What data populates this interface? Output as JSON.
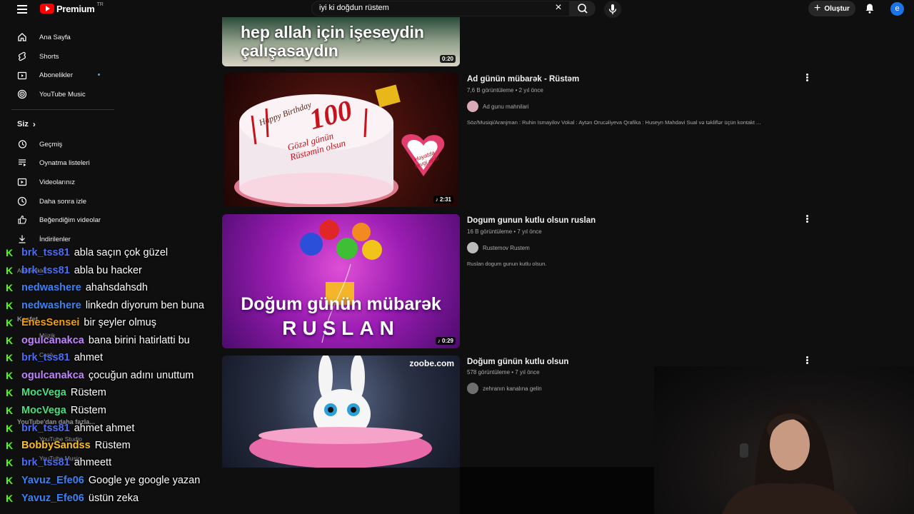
{
  "header": {
    "brand": "Premium",
    "brand_tm": "TR",
    "search_value": "iyi ki doğdun rüstem",
    "create_label": "Oluştur",
    "avatar_letter": "e"
  },
  "sidebar": {
    "items": [
      {
        "label": "Ana Sayfa",
        "icon": "home-icon"
      },
      {
        "label": "Shorts",
        "icon": "shorts-icon"
      },
      {
        "label": "Abonelikler",
        "icon": "subscriptions-icon"
      },
      {
        "label": "YouTube Music",
        "icon": "youtube-music-icon"
      }
    ],
    "you_header": "Siz",
    "you_items": [
      {
        "label": "Geçmiş",
        "icon": "history-icon"
      },
      {
        "label": "Oynatma listeleri",
        "icon": "playlists-icon"
      },
      {
        "label": "Videolarınız",
        "icon": "your-videos-icon"
      },
      {
        "label": "Daha sonra izle",
        "icon": "watch-later-icon"
      },
      {
        "label": "Beğendiğim videolar",
        "icon": "liked-videos-icon"
      },
      {
        "label": "İndirilenler",
        "icon": "downloads-icon"
      }
    ],
    "faded_items": [
      "Abonelikler",
      "Keşfet",
      "Müzik",
      "Canlı",
      "YouTube'dan daha fazla...",
      "YouTube Studio",
      "YouTube Music"
    ]
  },
  "videos": [
    {
      "title": "",
      "overlay_text": "hep allah için işeseydin çalışasaydın",
      "duration": "0:20"
    },
    {
      "title": "Ad günün mübarək - Rüstəm",
      "meta": "7,6 B görüntüleme • 2 yıl önce",
      "channel": "Ad gunu mahnilari",
      "description": "Söz/Musiqi/Aranjman : Ruhin Ismayilov Vokal : Aytən Orucəliyeva Qrafika : Huseyn Mahdavi Sual və təkliflər üçün kontakt ...",
      "duration": "2:31",
      "thumb_texts": [
        "Happy Birthday",
        "100",
        "Gözəl günün Rüstəmin olsun",
        "Həyatda sevgi dolu"
      ]
    },
    {
      "title": "Dogum gunun kutlu olsun ruslan",
      "meta": "16 B görüntüleme • 7 yıl önce",
      "channel": "Rustemov Rustem",
      "description": "Ruslan dogum gunun kutlu olsun.",
      "duration": "0:29",
      "thumb_texts": [
        "Doğum günün mübarək",
        "RUSLAN"
      ]
    },
    {
      "title": "Doğum günün kutlu olsun",
      "meta": "578 görüntüleme • 7 yıl önce",
      "channel": "zehranın kanalına gelin",
      "thumb_texts": [
        "zoobe.com"
      ]
    }
  ],
  "chat": [
    {
      "user": "brk_tss81",
      "msg": "abla saçın çok güzel",
      "color": "#4a6cf7"
    },
    {
      "user": "brk_tss81",
      "msg": "abla bu hacker",
      "color": "#4a6cf7"
    },
    {
      "user": "nedwashere",
      "msg": "ahahsdahsdh",
      "color": "#3b82f6"
    },
    {
      "user": "nedwashere",
      "msg": "linkedn diyorum ben buna",
      "color": "#3b82f6"
    },
    {
      "user": "EnesSensei",
      "msg": "bir şeyler olmuş",
      "color": "#f59e0b"
    },
    {
      "user": "ogulcanakca",
      "msg": "bana birini hatirlatti bu",
      "color": "#c084fc"
    },
    {
      "user": "brk_tss81",
      "msg": "ahmet",
      "color": "#4a6cf7"
    },
    {
      "user": "ogulcanakca",
      "msg": "çocuğun adını unuttum",
      "color": "#c084fc"
    },
    {
      "user": "MocVega",
      "msg": "Rüstem",
      "color": "#4ade80"
    },
    {
      "user": "MocVega",
      "msg": "Rüstem",
      "color": "#4ade80"
    },
    {
      "user": "brk_tss81",
      "msg": "ahmet ahmet",
      "color": "#4a6cf7"
    },
    {
      "user": "BobbySandss",
      "msg": "Rüstem",
      "color": "#fbbf24"
    },
    {
      "user": "brk_tss81",
      "msg": "ahmeett",
      "color": "#4a6cf7"
    },
    {
      "user": "Yavuz_Efe06",
      "msg": "Google ye google yazan",
      "color": "#3b82f6"
    },
    {
      "user": "Yavuz_Efe06",
      "msg": "üstün zeka",
      "color": "#3b82f6"
    }
  ],
  "colors": {
    "accent": "#ff0000",
    "kick_green": "#53fc18",
    "link_blue": "#3ea6ff"
  }
}
